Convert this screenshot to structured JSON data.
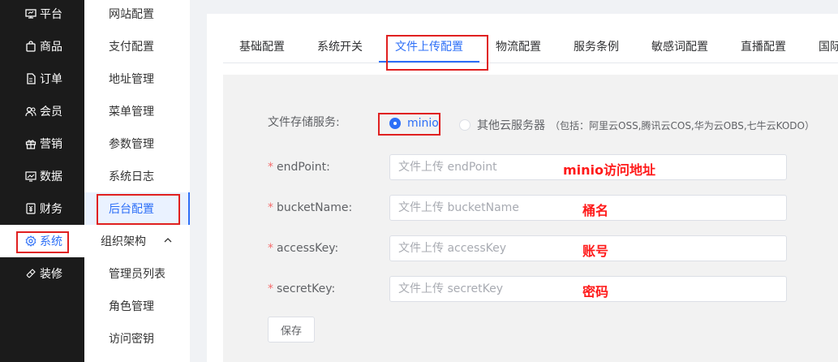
{
  "primary_nav": [
    {
      "label": "平台",
      "icon": "monitor-icon"
    },
    {
      "label": "商品",
      "icon": "bag-icon"
    },
    {
      "label": "订单",
      "icon": "document-icon"
    },
    {
      "label": "会员",
      "icon": "users-icon"
    },
    {
      "label": "营销",
      "icon": "gift-icon"
    },
    {
      "label": "数据",
      "icon": "chart-icon"
    },
    {
      "label": "财务",
      "icon": "finance-icon"
    },
    {
      "label": "系统",
      "icon": "gear-icon",
      "active": true
    },
    {
      "label": "装修",
      "icon": "decor-icon"
    }
  ],
  "secondary_nav": {
    "items": [
      "网站配置",
      "支付配置",
      "地址管理",
      "菜单管理",
      "参数管理",
      "系统日志",
      "后台配置"
    ],
    "active": "后台配置",
    "group": {
      "label": "组织架构",
      "expanded": true,
      "items": [
        "管理员列表",
        "角色管理",
        "访问密钥"
      ]
    }
  },
  "tabs": [
    "基础配置",
    "系统开关",
    "文件上传配置",
    "物流配置",
    "服务条例",
    "敏感词配置",
    "直播配置",
    "国际"
  ],
  "active_tab": "文件上传配置",
  "form": {
    "storage_label": "文件存储服务:",
    "option_minio": "minio",
    "option_other": "其他云服务器",
    "option_other_hint": "（包括：阿里云OSS,腾讯云COS,华为云OBS,七牛云KODO）",
    "selected": "minio",
    "fields": [
      {
        "label": "endPoint:",
        "placeholder": "文件上传 endPoint",
        "value": "",
        "annotation": "minio访问地址"
      },
      {
        "label": "bucketName:",
        "placeholder": "文件上传 bucketName",
        "value": "",
        "annotation": "桶名"
      },
      {
        "label": "accessKey:",
        "placeholder": "文件上传 accessKey",
        "value": "",
        "annotation": "账号"
      },
      {
        "label": "secretKey:",
        "placeholder": "文件上传 secretKey",
        "value": "",
        "annotation": "密码"
      }
    ],
    "required_mark": "*",
    "save_label": "保存"
  },
  "colors": {
    "primary": "#2d6ff7",
    "sidebar_bg": "#1b1b1b",
    "highlight": "#e02020",
    "annotation": "#ff1a1a"
  }
}
